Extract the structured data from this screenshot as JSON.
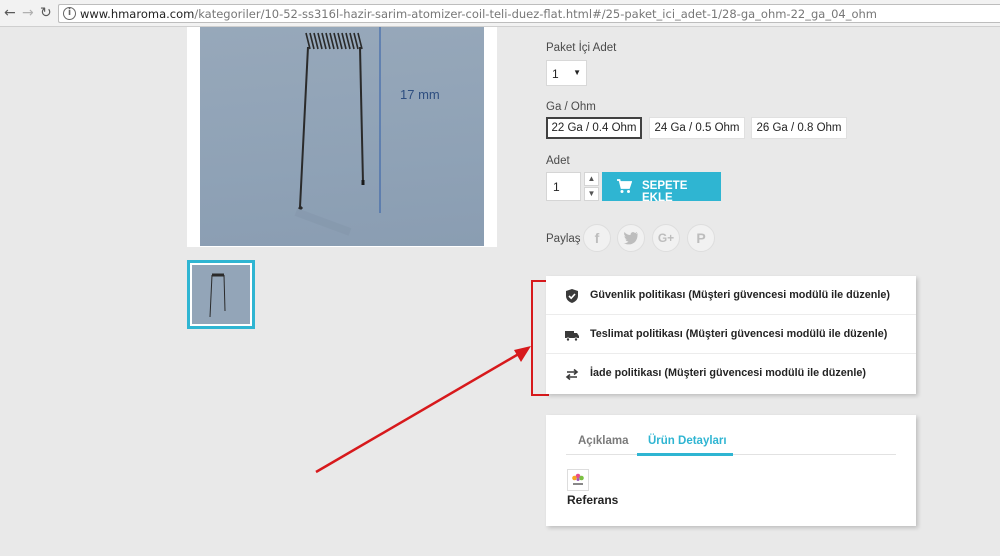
{
  "browser": {
    "back_icon": "arrow-left-icon",
    "forward_icon": "arrow-right-icon",
    "url_host": "www.hmaroma.com",
    "url_path": "/kategoriler/10-52-ss316l-hazir-sarim-atomizer-coil-teli-duez-flat.html#/25-paket_ici_adet-1/28-ga_ohm-22_ga_04_ohm"
  },
  "product": {
    "image_dimension_label": "17 mm",
    "paket_label": "Paket İçi Adet",
    "paket_value": "1",
    "ga_label": "Ga / Ohm",
    "ga_options": [
      "22 Ga / 0.4 Ohm",
      "24 Ga / 0.5 Ohm",
      "26 Ga / 0.8 Ohm"
    ],
    "ga_selected": "22 Ga / 0.4 Ohm",
    "adet_label": "Adet",
    "adet_value": "1",
    "add_to_cart_label": "SEPETE EKLE",
    "share_label": "Paylaş",
    "share_icons": [
      "facebook-icon",
      "twitter-icon",
      "google-plus-icon",
      "pinterest-icon"
    ]
  },
  "policies": [
    {
      "icon": "shield-check-icon",
      "text": "Güvenlik politikası (Müşteri güvencesi modülü ile düzenle)"
    },
    {
      "icon": "truck-icon",
      "text": "Teslimat politikası (Müşteri güvencesi modülü ile düzenle)"
    },
    {
      "icon": "swap-arrows-icon",
      "text": "İade politikası (Müşteri güvencesi modülü ile düzenle)"
    }
  ],
  "tabs": {
    "items": [
      "Açıklama",
      "Ürün Detayları"
    ],
    "active": "Ürün Detayları",
    "reference_label": "Referans"
  },
  "colors": {
    "accent": "#2fb5d2",
    "annotation_red": "#d7191c",
    "background": "#e9e9e9"
  }
}
